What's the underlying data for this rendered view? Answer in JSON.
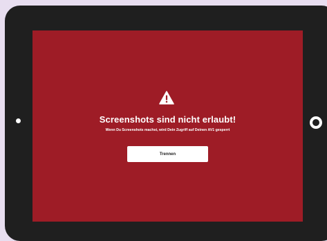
{
  "dialog": {
    "icon": "warning-triangle-icon",
    "title": "Screenshots sind nicht erlaubt!",
    "message": "Wenn Du Screenshots machst, wird Dein Zugriff auf Deinen AV1 gesperrt",
    "button_label": "Trennen"
  },
  "colors": {
    "background": "#e8def0",
    "device_frame": "#1f1f1f",
    "screen_bg": "#9e1c26",
    "text": "#ffffff",
    "button_bg": "#ffffff",
    "button_text": "#222222"
  }
}
